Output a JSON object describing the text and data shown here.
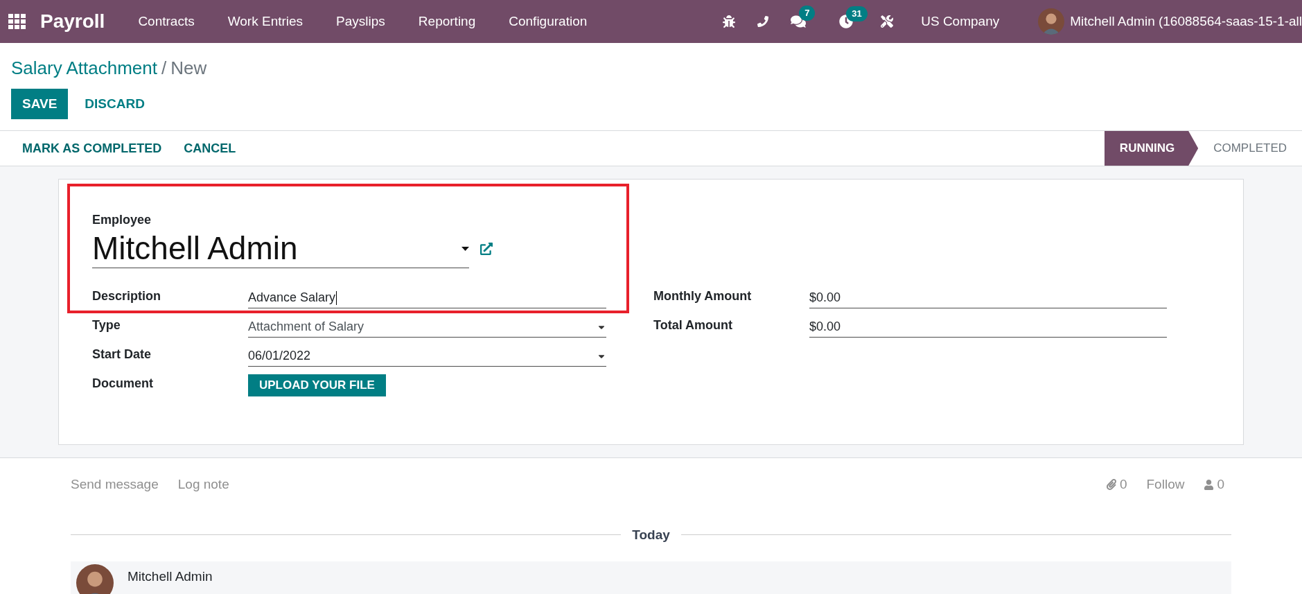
{
  "navbar": {
    "app": "Payroll",
    "menu": [
      "Contracts",
      "Work Entries",
      "Payslips",
      "Reporting",
      "Configuration"
    ],
    "messages_count": "7",
    "activities_count": "31",
    "company": "US Company",
    "user": "Mitchell Admin (16088564-saas-15-1-all"
  },
  "breadcrumb": {
    "parent": "Salary Attachment",
    "separator": "/",
    "current": "New"
  },
  "buttons": {
    "save": "SAVE",
    "discard": "DISCARD"
  },
  "actions": [
    "MARK AS COMPLETED",
    "CANCEL"
  ],
  "stages": [
    {
      "label": "RUNNING",
      "selected": true
    },
    {
      "label": "COMPLETED",
      "selected": false
    }
  ],
  "employee": {
    "label": "Employee",
    "value": "Mitchell Admin"
  },
  "left_fields": [
    {
      "label": "Description",
      "kind": "input",
      "value": "Advance Salary"
    },
    {
      "label": "Type",
      "kind": "select",
      "value": "Attachment of Salary"
    },
    {
      "label": "Start Date",
      "kind": "select",
      "value": "06/01/2022"
    },
    {
      "label": "Document",
      "kind": "upload",
      "value": "UPLOAD YOUR FILE"
    }
  ],
  "right_fields": [
    {
      "label": "Monthly Amount",
      "value": "$0.00"
    },
    {
      "label": "Total Amount",
      "value": "$0.00"
    }
  ],
  "chatter": {
    "send": "Send message",
    "log": "Log note",
    "attachments": "0",
    "follow": "Follow",
    "followers": "0",
    "date": "Today",
    "author": "Mitchell Admin"
  }
}
